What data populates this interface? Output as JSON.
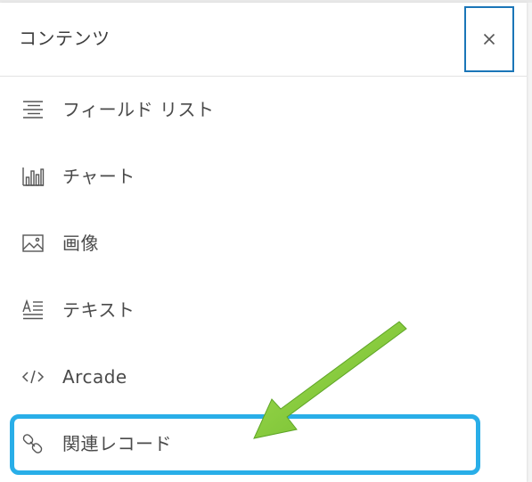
{
  "panel": {
    "title": "コンテンツ",
    "close_label": "×",
    "colors": {
      "close_border": "#1b76b8",
      "highlight": "#29aee8",
      "arrow": "#7dc832"
    }
  },
  "items": [
    {
      "label": "フィールド リスト",
      "icon": "field-list-icon"
    },
    {
      "label": "チャート",
      "icon": "bar-chart-icon"
    },
    {
      "label": "画像",
      "icon": "image-icon"
    },
    {
      "label": "テキスト",
      "icon": "text-icon"
    },
    {
      "label": "Arcade",
      "icon": "code-icon"
    },
    {
      "label": "関連レコード",
      "icon": "link-icon"
    }
  ]
}
